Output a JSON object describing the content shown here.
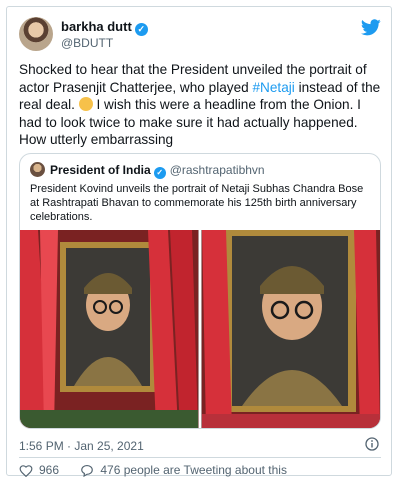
{
  "author": {
    "name": "barkha dutt",
    "handle": "@BDUTT"
  },
  "tweet": {
    "text_before": "Shocked to hear that the President unveiled the portrait of actor Prasenjit Chatterjee, who played ",
    "hashtag": "#Netaji",
    "text_middle": " instead of the real deal. ",
    "text_after": " I wish this were a headline from the Onion. I had to look twice to make sure it had actually happened. How utterly embarrassing"
  },
  "quoted": {
    "name": "President of India",
    "handle": "@rashtrapatibhvn",
    "text": "President Kovind unveils the portrait of Netaji Subhas Chandra Bose at Rashtrapati Bhavan to commemorate his 125th birth anniversary celebrations."
  },
  "meta": {
    "timestamp": "1:56 PM · Jan 25, 2021",
    "likes": "966",
    "retweet_text": "476 people are Tweeting about this"
  },
  "colors": {
    "accent": "#1d9bf0",
    "text": "#0f1419",
    "secondary": "#536471",
    "border": "#cfd9de"
  },
  "icons": [
    "verified-badge-icon",
    "twitter-bird-icon",
    "info-icon",
    "heart-icon",
    "comment-icon"
  ]
}
